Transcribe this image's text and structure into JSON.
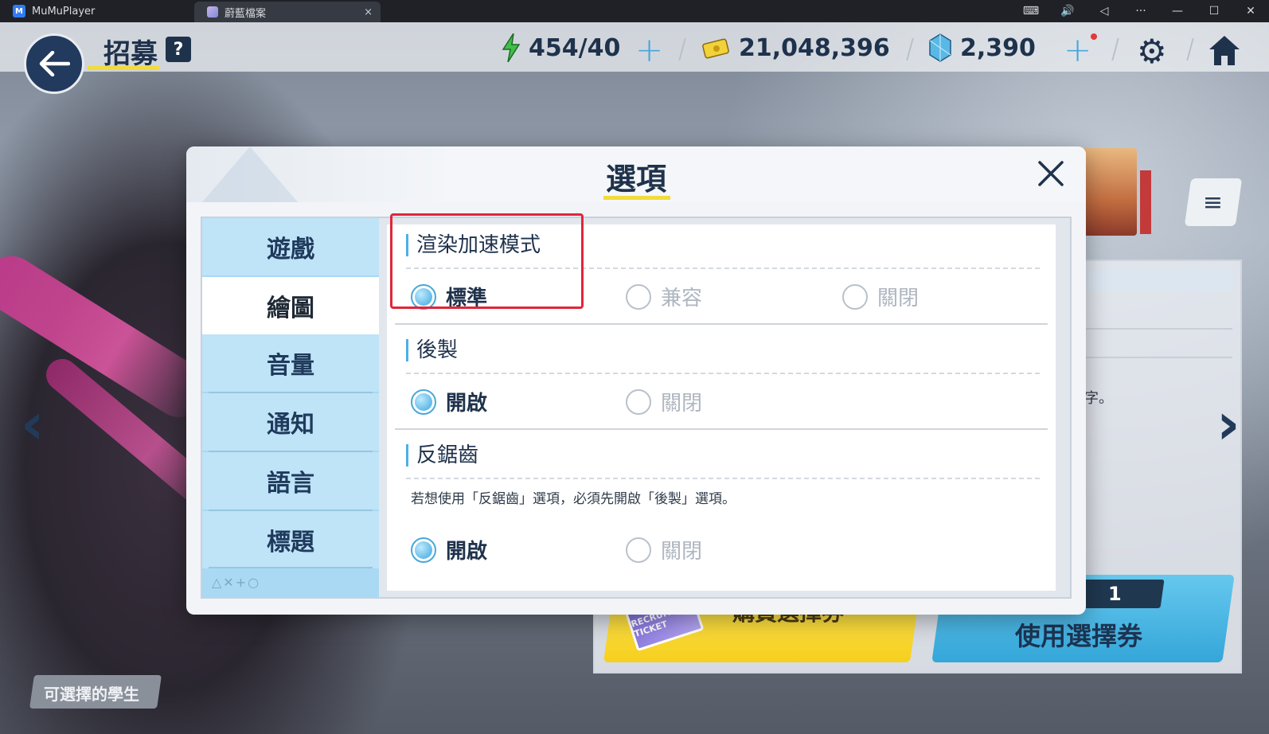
{
  "titlebar": {
    "app_name": "MuMuPlayer",
    "game_tab": "蔚藍檔案",
    "close_tab": "×",
    "controls": [
      "⌨",
      "🔊",
      "◁",
      "···",
      "—",
      "☐",
      "✕"
    ]
  },
  "hud": {
    "title": "招募",
    "help": "?",
    "stamina": "454/40",
    "credits": "21,048,396",
    "gems": "2,390",
    "plus": "+"
  },
  "background": {
    "text_fragment": "字。",
    "buy_button": "購買選擇券",
    "ticket_label": "RECRUIT TICKET",
    "use_count": "1",
    "use_button": "使用選擇券",
    "student_chip": "可選擇的學生",
    "menu_icon": "≡"
  },
  "dialog": {
    "title": "選項",
    "close": "✕",
    "sidebar": {
      "items": [
        "遊戲",
        "繪圖",
        "音量",
        "通知",
        "語言",
        "標題"
      ],
      "active_index": 1,
      "glyphs": "△✕+○"
    },
    "sections": {
      "render": {
        "title": "渲染加速模式",
        "options": [
          "標準",
          "兼容",
          "關閉"
        ],
        "selected": "標準"
      },
      "postprocess": {
        "title": "後製",
        "options": [
          "開啟",
          "關閉"
        ],
        "selected": "開啟"
      },
      "antialias": {
        "title": "反鋸齒",
        "note": "若想使用「反鋸齒」選項，必須先開啟「後製」選項。",
        "options": [
          "開啟",
          "關閉"
        ],
        "selected": "開啟"
      }
    }
  },
  "colors": {
    "accent_blue": "#4ab0e8",
    "navy": "#1f324c",
    "highlight_red": "#e0263a",
    "underline_yellow": "#f2dc3c"
  }
}
